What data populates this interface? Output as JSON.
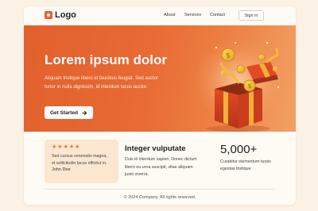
{
  "header": {
    "logo_text": "Logo",
    "nav": [
      "About",
      "Services",
      "Contact"
    ],
    "signin_label": "Sign in"
  },
  "hero": {
    "title": "Lorem ipsum dolor",
    "description": "Aliquam tristique libero id faucibus feugiat. Sed auctor tortor in nulla dignissim, id interdum lacus auctor.",
    "cta_label": "Get Started",
    "cta_icon": "arrow-right-icon",
    "illustration": "gift-box-coins"
  },
  "testimonial": {
    "rating": 5,
    "max_rating": 5,
    "quote": "Sed cursus venenatis magna, et sollicitudin lacus efficitur in.",
    "author": "John Doe"
  },
  "feature": {
    "title": "Integer vulputate",
    "text": "Duis id interdum sapien, Donec dictum libero eu urna suscipit, vitae aliquam justo viverra."
  },
  "stat": {
    "value": "5,000+",
    "text": "Curabitur elementum turpis egestas tristique"
  },
  "footer": {
    "copyright": "© 2024 Company. All rights reserved."
  },
  "colors": {
    "accent": "#e8612c",
    "background": "#fbf1e4",
    "card": "#fbe6cf",
    "star": "#ea7b2b"
  }
}
